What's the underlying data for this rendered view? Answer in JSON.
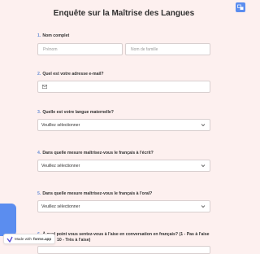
{
  "title": "Enquête sur la Maîtrise des Langues",
  "questions": [
    {
      "number": "1.",
      "label": "Nom complet",
      "first_placeholder": "Prénom",
      "last_placeholder": "Nom de famille"
    },
    {
      "number": "2.",
      "label": "Quel est votre adresse e-mail?"
    },
    {
      "number": "3.",
      "label": "Quelle est votre langue maternelle?",
      "select_value": "Veuillez sélectionner"
    },
    {
      "number": "4.",
      "label": "Dans quelle mesure maîtrisez-vous le français à l'écrit?",
      "select_value": "Veuillez sélectionner"
    },
    {
      "number": "5.",
      "label": "Dans quelle mesure maîtrisez-vous le français à l'oral?",
      "select_value": "Veuillez sélectionner"
    },
    {
      "number": "6.",
      "label_line1": "À quel point vous sentez-vous à l'aise en conversation en français? (1 - Pas à l'aise",
      "label_line2": "10 - Très à l'aise)"
    }
  ],
  "badge": {
    "prefix": "Made with",
    "brand": "forms.app"
  },
  "colors": {
    "accent": "#5b8def",
    "background": "#fdf0ef"
  }
}
